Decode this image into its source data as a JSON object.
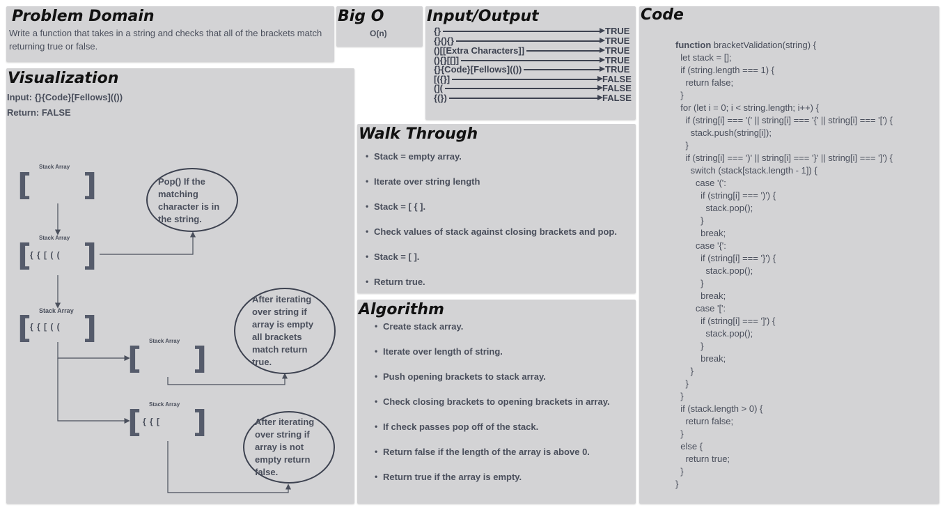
{
  "problem_domain": {
    "title": "Problem Domain",
    "text": "Write a function that takes in a string and checks that all of the brackets match returning true or false."
  },
  "big_o": {
    "title": "Big O",
    "value": "O(n)"
  },
  "io": {
    "title": "Input/Output",
    "rows": [
      {
        "input": "{}",
        "output": "TRUE"
      },
      {
        "input": "{}(){}",
        "output": "TRUE"
      },
      {
        "input": "()[[Extra Characters]]",
        "output": "TRUE"
      },
      {
        "input": "(){}[[]]",
        "output": "TRUE"
      },
      {
        "input": "{}{Code}[Fellows](())",
        "output": "TRUE"
      },
      {
        "input": "[({}]",
        "output": "FALSE"
      },
      {
        "input": "(](",
        "output": "FALSE"
      },
      {
        "input": "{(})",
        "output": "FALSE"
      }
    ]
  },
  "visualization": {
    "title": "Visualization",
    "input_line": "Input: {}{Code}[Fellows](())",
    "return_line": "Return: FALSE",
    "stack_label": "Stack Array",
    "bracket_open": "[",
    "bracket_close": "]",
    "stack_full": "{ { [ ( (",
    "stack_partial": "{ { [",
    "bubble_pop": "Pop() If the matching character is in the string.",
    "bubble_empty": "After iterating over string if array is empty all brackets match return true.",
    "bubble_not_empty": "After iterating over string if array is not empty  return false."
  },
  "walkthrough": {
    "title": "Walk Through",
    "items": [
      "Stack = empty array.",
      "Iterate over string length",
      "Stack = [ { ].",
      "Check values of stack against closing brackets and pop.",
      "Stack = [ ].",
      "Return true."
    ]
  },
  "algorithm": {
    "title": "Algorithm",
    "items": [
      "Create stack array.",
      "Iterate over length of string.",
      "Push opening brackets to stack array.",
      "Check closing brackets to opening brackets in array.",
      "If check passes pop off of the stack.",
      "Return false if the length of the array is above 0.",
      "Return true if the array is empty."
    ]
  },
  "code": {
    "title": "Code",
    "keyword": "function",
    "first_line_rest": " bracketValidation(string) {",
    "lines": [
      "  let stack = [];",
      "  if (string.length === 1) {",
      "    return false;",
      "  }",
      "  for (let i = 0; i < string.length; i++) {",
      "    if (string[i] === '(' || string[i] === '{' || string[i] === '[') {",
      "      stack.push(string[i]);",
      "    }",
      "    if (string[i] === ')' || string[i] === '}' || string[i] === ']') {",
      "      switch (stack[stack.length - 1]) {",
      "        case '(':",
      "          if (string[i] === ')') {",
      "            stack.pop();",
      "          }",
      "          break;",
      "        case '{':",
      "          if (string[i] === '}') {",
      "            stack.pop();",
      "          }",
      "          break;",
      "        case '[':",
      "          if (string[i] === ']') {",
      "            stack.pop();",
      "          }",
      "          break;",
      "      }",
      "    }",
      "  }",
      "  if (stack.length > 0) {",
      "    return false;",
      "  }",
      "  else {",
      "    return true;",
      "  }",
      "}"
    ]
  }
}
